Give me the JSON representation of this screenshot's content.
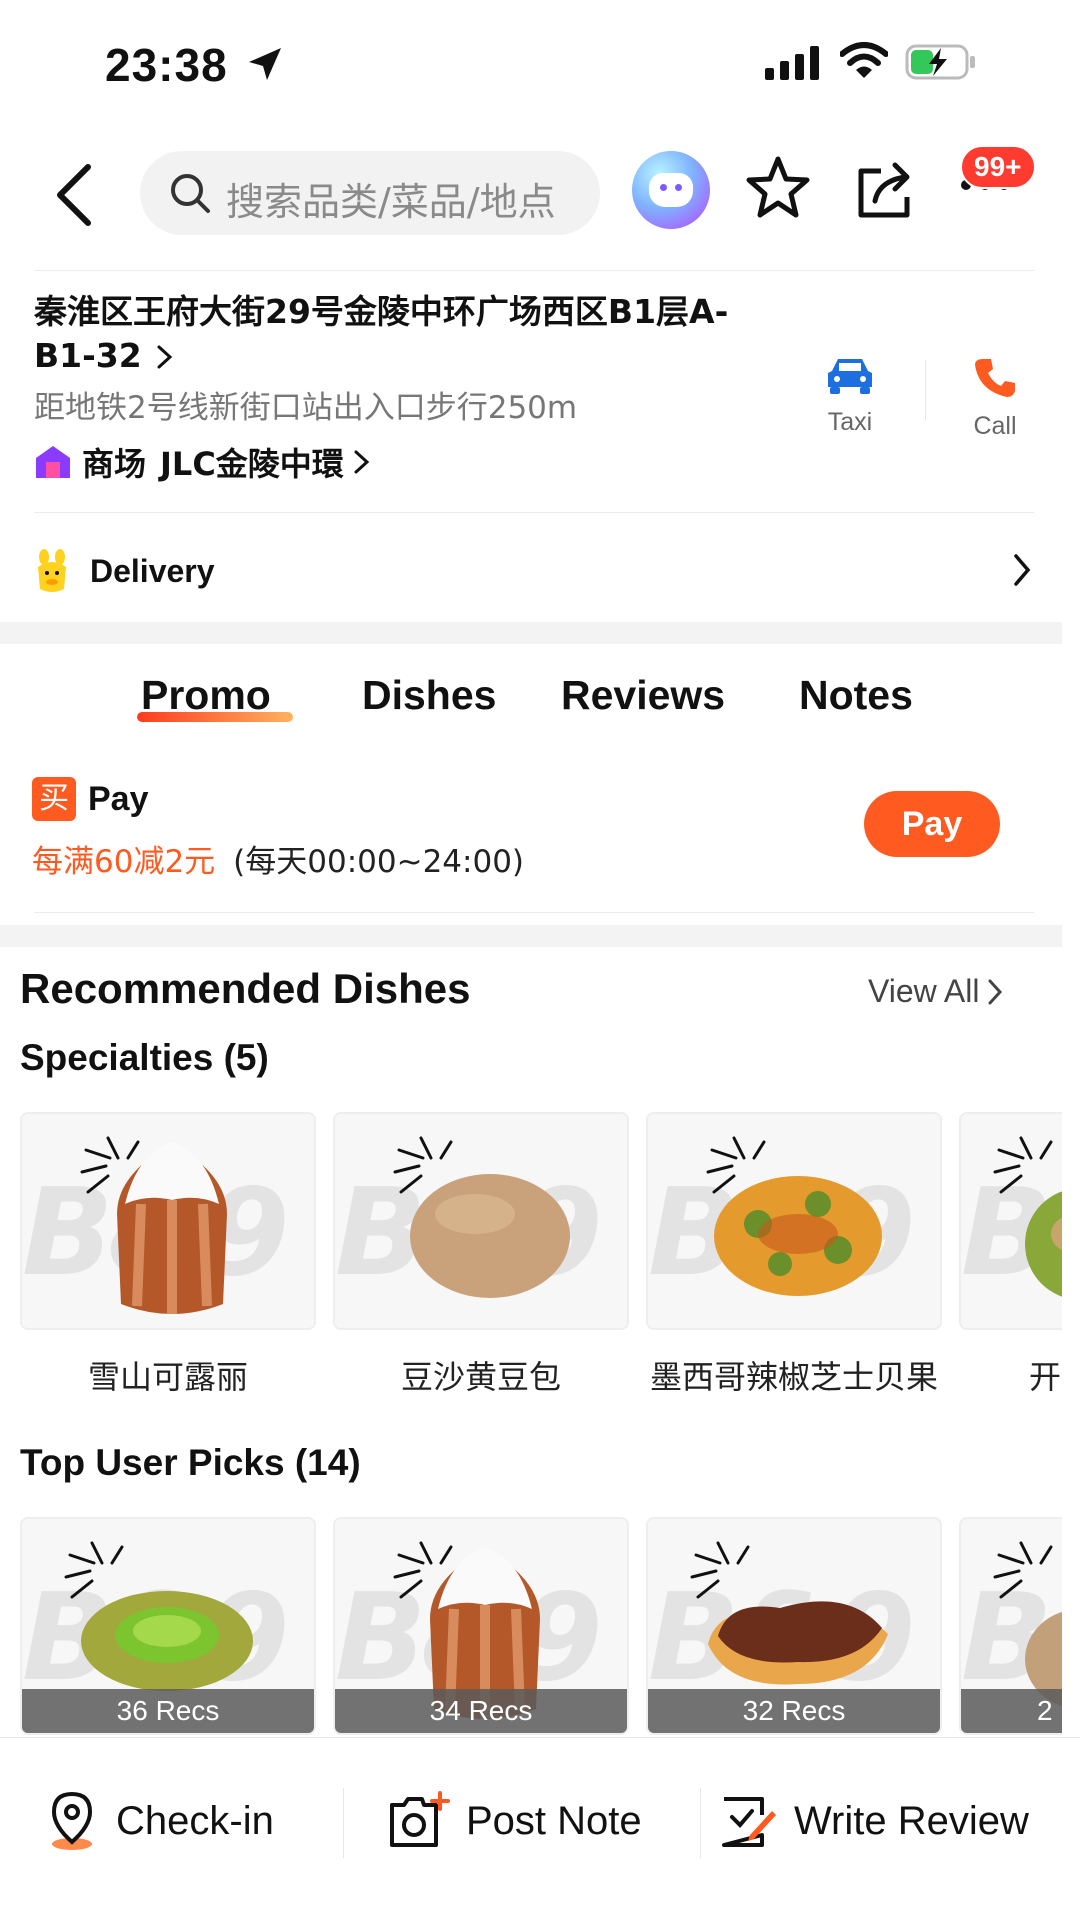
{
  "status_bar": {
    "time": "23:38"
  },
  "header": {
    "search_placeholder": "搜索品类/菜品/地点",
    "notification_badge": "99+"
  },
  "shop": {
    "address_line": "秦淮区王府大街29号金陵中环广场西区B1层A-B1-32",
    "distance": "距地铁2号线新街口站出入口步行250m",
    "mall_prefix": "商场",
    "mall_name": "JLC金陵中環",
    "actions": {
      "taxi_label": "Taxi",
      "call_label": "Call"
    },
    "delivery_label": "Delivery"
  },
  "tabs": [
    {
      "label": "Promo",
      "active": true
    },
    {
      "label": "Dishes",
      "active": false
    },
    {
      "label": "Reviews",
      "active": false
    },
    {
      "label": "Notes",
      "active": false
    }
  ],
  "promo": {
    "tag": "买",
    "title": "Pay",
    "offer": "每满60减2元",
    "time_range": "(每天00:00~24:00)",
    "button_label": "Pay"
  },
  "recommended": {
    "title": "Recommended Dishes",
    "view_all": "View All",
    "specialties": {
      "title": "Specialties (5)",
      "items": [
        {
          "name": "雪山可露丽",
          "icon": "canele-image"
        },
        {
          "name": "豆沙黄豆包",
          "icon": "bun-image"
        },
        {
          "name": "墨西哥辣椒芝士贝果",
          "icon": "bagel-image"
        },
        {
          "name": "开",
          "icon": "pastry-image"
        }
      ]
    },
    "top_user_picks": {
      "title": "Top User Picks (14)",
      "items": [
        {
          "recs": "36 Recs",
          "icon": "pistachio-tart-image"
        },
        {
          "recs": "34 Recs",
          "icon": "canele-image"
        },
        {
          "recs": "32 Recs",
          "icon": "chocolate-pastry-image"
        },
        {
          "recs": "2",
          "icon": "pastry-image"
        }
      ]
    }
  },
  "bottom_bar": {
    "checkin": "Check-in",
    "post_note": "Post Note",
    "write_review": "Write Review"
  },
  "colors": {
    "accent": "#ff5a1f",
    "taxi_blue": "#1d6fe0",
    "call_orange": "#ff5a1f"
  }
}
